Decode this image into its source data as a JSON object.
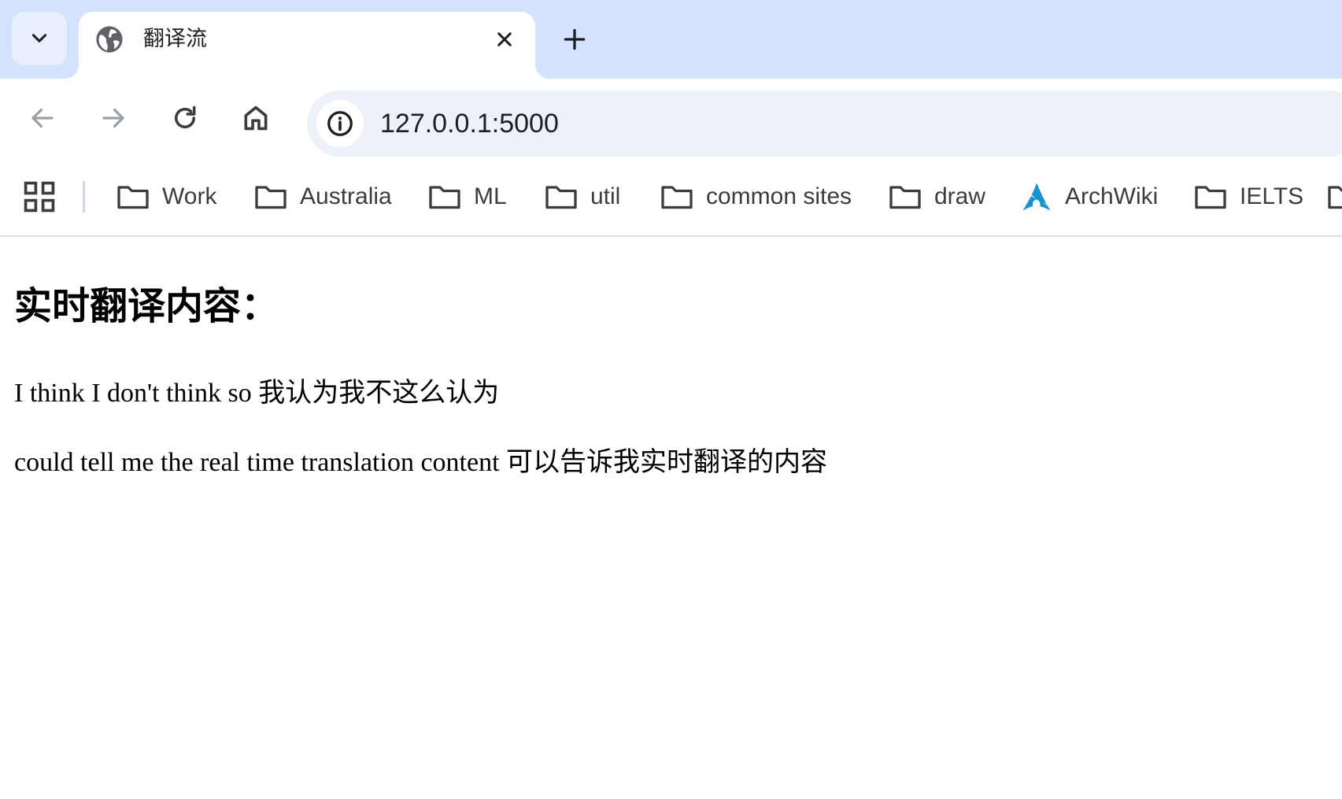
{
  "tab": {
    "title": "翻译流",
    "favicon": "globe-icon"
  },
  "toolbar": {
    "url": "127.0.0.1:5000"
  },
  "bookmarks": {
    "items": [
      {
        "label": "Work",
        "icon": "folder-icon"
      },
      {
        "label": "Australia",
        "icon": "folder-icon"
      },
      {
        "label": "ML",
        "icon": "folder-icon"
      },
      {
        "label": "util",
        "icon": "folder-icon"
      },
      {
        "label": "common sites",
        "icon": "folder-icon"
      },
      {
        "label": "draw",
        "icon": "folder-icon"
      },
      {
        "label": "ArchWiki",
        "icon": "archlinux-icon"
      },
      {
        "label": "IELTS",
        "icon": "folder-icon"
      }
    ]
  },
  "page": {
    "heading": "实时翻译内容：",
    "lines": [
      "I think I don't think so 我认为我不这么认为",
      "could tell me the real time translation content 可以告诉我实时翻译的内容"
    ]
  },
  "colors": {
    "tabstrip": "#d3e3fd",
    "omnibox": "#edf2fa",
    "archwiki_blue": "#1793d1"
  }
}
